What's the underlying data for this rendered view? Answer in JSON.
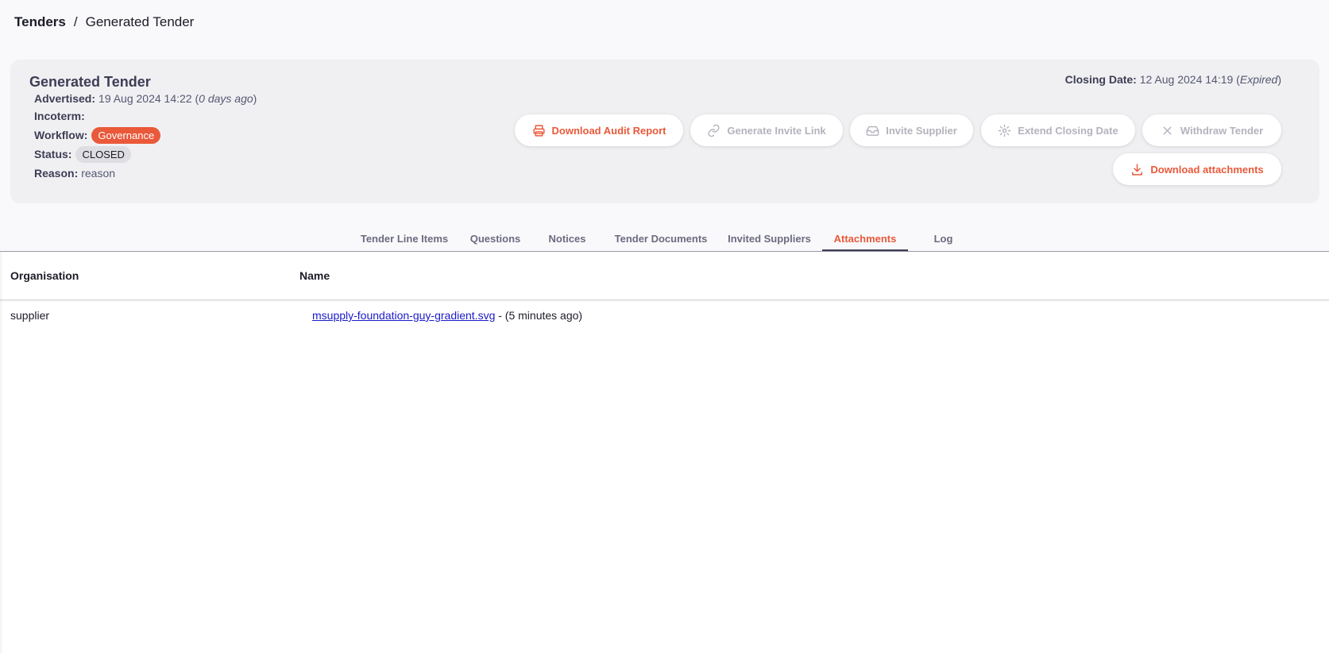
{
  "breadcrumb": {
    "root": "Tenders",
    "separator": "/",
    "current": "Generated Tender"
  },
  "tender": {
    "title": "Generated Tender",
    "advertised": {
      "label": "Advertised:",
      "date": "19 Aug 2024 14:22",
      "relative": "0 days ago"
    },
    "incoterm": {
      "label": "Incoterm:",
      "value": ""
    },
    "workflow": {
      "label": "Workflow:",
      "value": "Governance"
    },
    "status": {
      "label": "Status:",
      "value": "CLOSED"
    },
    "reason": {
      "label": "Reason:",
      "value": "reason"
    },
    "closing": {
      "label": "Closing Date:",
      "date": "12 Aug 2024 14:19",
      "state": "Expired"
    }
  },
  "actions": {
    "download_audit": "Download Audit Report",
    "generate_invite": "Generate Invite Link",
    "invite_supplier": "Invite Supplier",
    "extend_closing": "Extend Closing Date",
    "withdraw": "Withdraw Tender",
    "download_attachments": "Download attachments"
  },
  "icons": {
    "download_audit": "printer-icon",
    "generate_invite": "link-icon",
    "invite_supplier": "inbox-icon",
    "extend_closing": "gear-icon",
    "withdraw": "close-icon",
    "download_attachments": "download-icon"
  },
  "tabs": [
    {
      "label": "Tender Line Items"
    },
    {
      "label": "Questions"
    },
    {
      "label": "Notices"
    },
    {
      "label": "Tender Documents"
    },
    {
      "label": "Invited Suppliers"
    },
    {
      "label": "Attachments",
      "selected": true
    },
    {
      "label": "Log"
    }
  ],
  "table": {
    "columns": [
      "Organisation",
      "Name"
    ],
    "rows": [
      {
        "organisation": "supplier",
        "file": "msupply-foundation-guy-gradient.svg",
        "suffix": " - (5 minutes ago)"
      }
    ]
  },
  "colors": {
    "accent": "#e9593a",
    "disabled": "#b3b3bd",
    "card": "#f0f0f3",
    "link": "#1a1acc"
  }
}
